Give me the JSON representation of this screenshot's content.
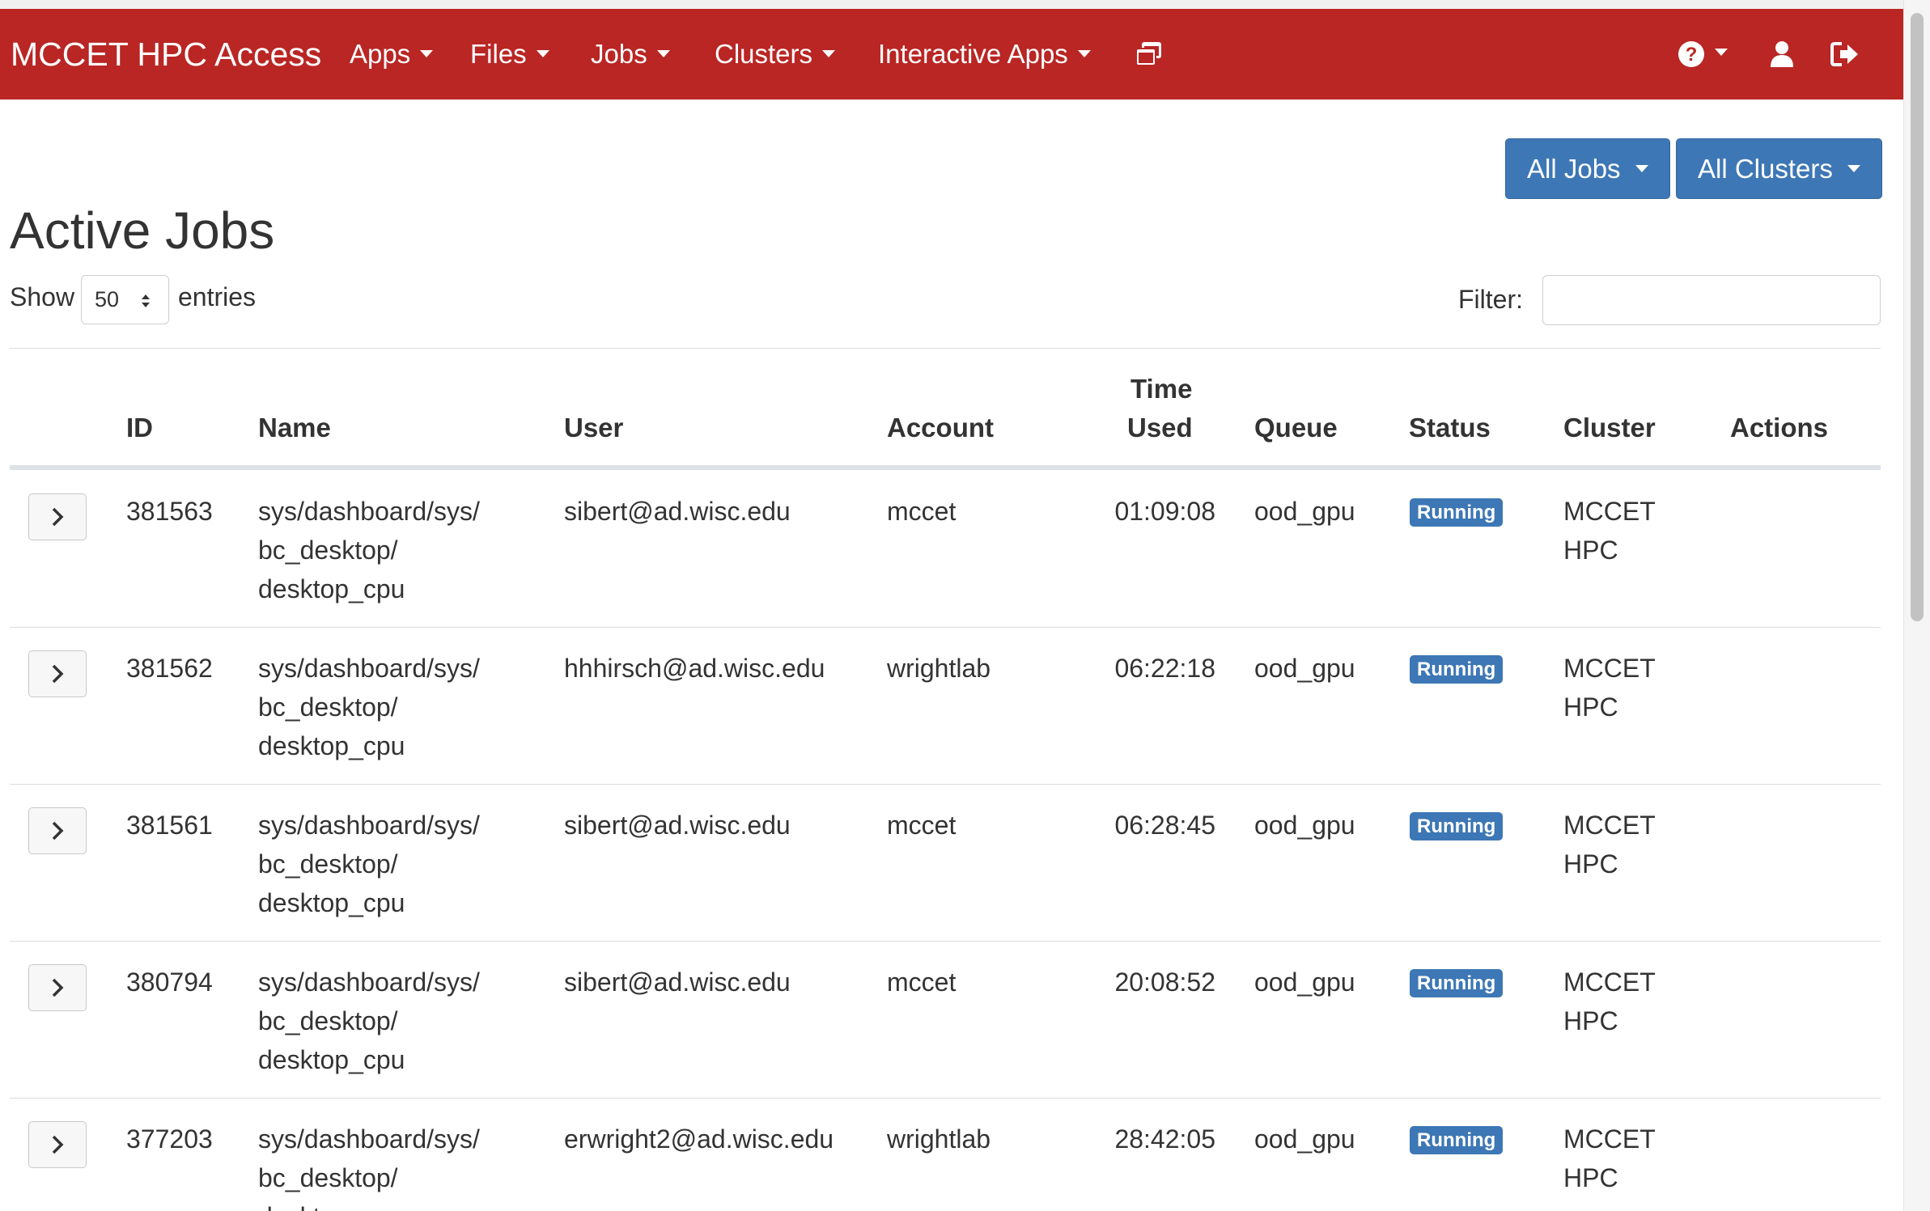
{
  "navbar": {
    "brand": "MCCET HPC Access",
    "menus": [
      "Apps",
      "Files",
      "Jobs",
      "Clusters",
      "Interactive Apps"
    ],
    "icons": [
      "windows-icon",
      "help-icon",
      "user-icon",
      "logout-icon"
    ]
  },
  "toolbar": {
    "jobs_filter": "All Jobs",
    "cluster_filter": "All Clusters"
  },
  "page": {
    "title": "Active Jobs"
  },
  "table_controls": {
    "show_label": "Show",
    "page_length": "50",
    "entries_label": "entries",
    "filter_label": "Filter:",
    "filter_value": ""
  },
  "table": {
    "headers": {
      "id": "ID",
      "name": "Name",
      "user": "User",
      "account": "Account",
      "time_used_line1": "Time",
      "time_used_line2": "Used",
      "queue": "Queue",
      "status": "Status",
      "cluster": "Cluster",
      "actions": "Actions"
    },
    "rows": [
      {
        "id": "381563",
        "name": [
          "sys/dashboard/sys/",
          "bc_desktop/",
          "desktop_cpu"
        ],
        "user": "sibert@ad.wisc.edu",
        "account": "mccet",
        "time_used": "01:09:08",
        "queue": "ood_gpu",
        "status": "Running",
        "cluster": [
          "MCCET",
          "HPC"
        ]
      },
      {
        "id": "381562",
        "name": [
          "sys/dashboard/sys/",
          "bc_desktop/",
          "desktop_cpu"
        ],
        "user": "hhhirsch@ad.wisc.edu",
        "account": "wrightlab",
        "time_used": "06:22:18",
        "queue": "ood_gpu",
        "status": "Running",
        "cluster": [
          "MCCET",
          "HPC"
        ]
      },
      {
        "id": "381561",
        "name": [
          "sys/dashboard/sys/",
          "bc_desktop/",
          "desktop_cpu"
        ],
        "user": "sibert@ad.wisc.edu",
        "account": "mccet",
        "time_used": "06:28:45",
        "queue": "ood_gpu",
        "status": "Running",
        "cluster": [
          "MCCET",
          "HPC"
        ]
      },
      {
        "id": "380794",
        "name": [
          "sys/dashboard/sys/",
          "bc_desktop/",
          "desktop_cpu"
        ],
        "user": "sibert@ad.wisc.edu",
        "account": "mccet",
        "time_used": "20:08:52",
        "queue": "ood_gpu",
        "status": "Running",
        "cluster": [
          "MCCET",
          "HPC"
        ]
      },
      {
        "id": "377203",
        "name": [
          "sys/dashboard/sys/",
          "bc_desktop/",
          "desktop_cpu"
        ],
        "user": "erwright2@ad.wisc.edu",
        "account": "wrightlab",
        "time_used": "28:42:05",
        "queue": "ood_gpu",
        "status": "Running",
        "cluster": [
          "MCCET",
          "HPC"
        ]
      }
    ]
  },
  "colors": {
    "navbar": "#b92624",
    "primary": "#3d77b5"
  }
}
